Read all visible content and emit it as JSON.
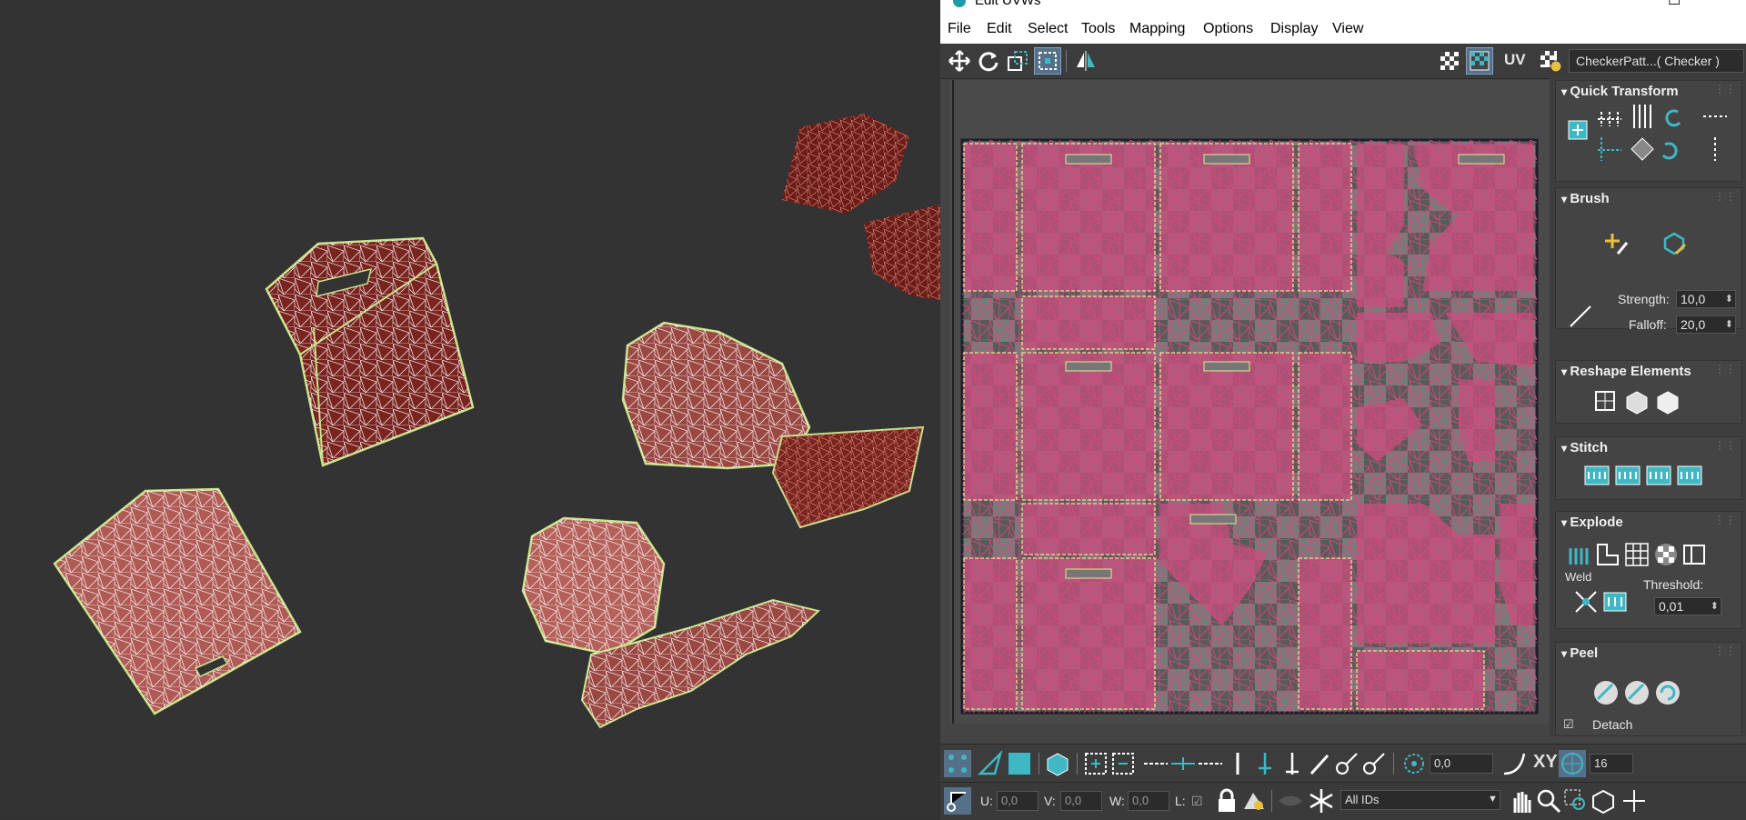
{
  "window": {
    "title": "Edit UVWs"
  },
  "menu": [
    "File",
    "Edit",
    "Select",
    "Tools",
    "Mapping",
    "Options",
    "Display",
    "View"
  ],
  "toolbar": {
    "uv_label": "UV",
    "map_select": "CheckerPatt...( Checker )"
  },
  "panels": {
    "quick_transform": {
      "title": "Quick Transform"
    },
    "brush": {
      "title": "Brush",
      "strength_label": "Strength:",
      "strength_value": "10,0",
      "falloff_label": "Falloff:",
      "falloff_value": "20,0"
    },
    "reshape": {
      "title": "Reshape Elements"
    },
    "stitch": {
      "title": "Stitch"
    },
    "explode": {
      "title": "Explode",
      "weld_label": "Weld",
      "threshold_label": "Threshold:",
      "threshold_value": "0,01"
    },
    "peel": {
      "title": "Peel",
      "detach_label": "Detach"
    }
  },
  "bottom": {
    "angle_value": "0,0",
    "xy_label": "XY",
    "grid_value": "16",
    "u_label": "U:",
    "u_value": "0,0",
    "v_label": "V:",
    "v_value": "0,0",
    "w_label": "W:",
    "w_value": "0,0",
    "l_label": "L:",
    "ids_select": "All IDs"
  },
  "colors": {
    "accent": "#3fb8c4",
    "uv_pink": "#e0457f",
    "mesh": "#7a2420",
    "selection": "#c8e38a"
  },
  "icons": [
    "move-icon",
    "rotate-icon",
    "scale-icon",
    "freeform-icon",
    "mirror-icon",
    "checker-icon",
    "lock-icon",
    "snowflake-icon",
    "hand-icon",
    "zoom-icon"
  ]
}
